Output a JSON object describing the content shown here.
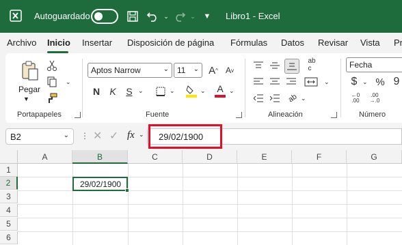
{
  "titlebar": {
    "autosave_label": "Autoguardado",
    "doc_title": "Libro1 - Excel",
    "icons": [
      "excel-logo",
      "save-icon",
      "undo-icon",
      "redo-icon",
      "customize-qat-icon"
    ]
  },
  "tabs": [
    "Archivo",
    "Inicio",
    "Insertar",
    "Disposición de página",
    "Fórmulas",
    "Datos",
    "Revisar",
    "Vista",
    "Pr"
  ],
  "active_tab": "Inicio",
  "ribbon": {
    "clipboard": {
      "paste_label": "Pegar",
      "group_label": "Portapapeles"
    },
    "font": {
      "font_name": "Aptos Narrow",
      "font_size": "11",
      "bold": "N",
      "italic": "K",
      "underline": "S",
      "font_color_glyph": "A",
      "grow_glyph": "A",
      "shrink_glyph": "A",
      "group_label": "Fuente"
    },
    "alignment": {
      "group_label": "Alineación"
    },
    "number": {
      "format": "Fecha",
      "currency_glyph": "$",
      "percent_glyph": "%",
      "comma_glyph": "9",
      "group_label": "Número"
    }
  },
  "formula_bar": {
    "name_box": "B2",
    "fx_label": "fx",
    "formula_value": "29/02/1900"
  },
  "grid": {
    "columns": [
      "A",
      "B",
      "C",
      "D",
      "E",
      "F",
      "G"
    ],
    "rows": [
      "1",
      "2",
      "3",
      "4",
      "5",
      "6"
    ],
    "selected_cell": "B2",
    "cell_B2": "29/02/1900"
  },
  "colors": {
    "brand_green": "#1e6b3c",
    "highlight_red": "#e0102a",
    "font_color_bar": "#e0102a",
    "fill_color_bar": "#ffe500"
  }
}
